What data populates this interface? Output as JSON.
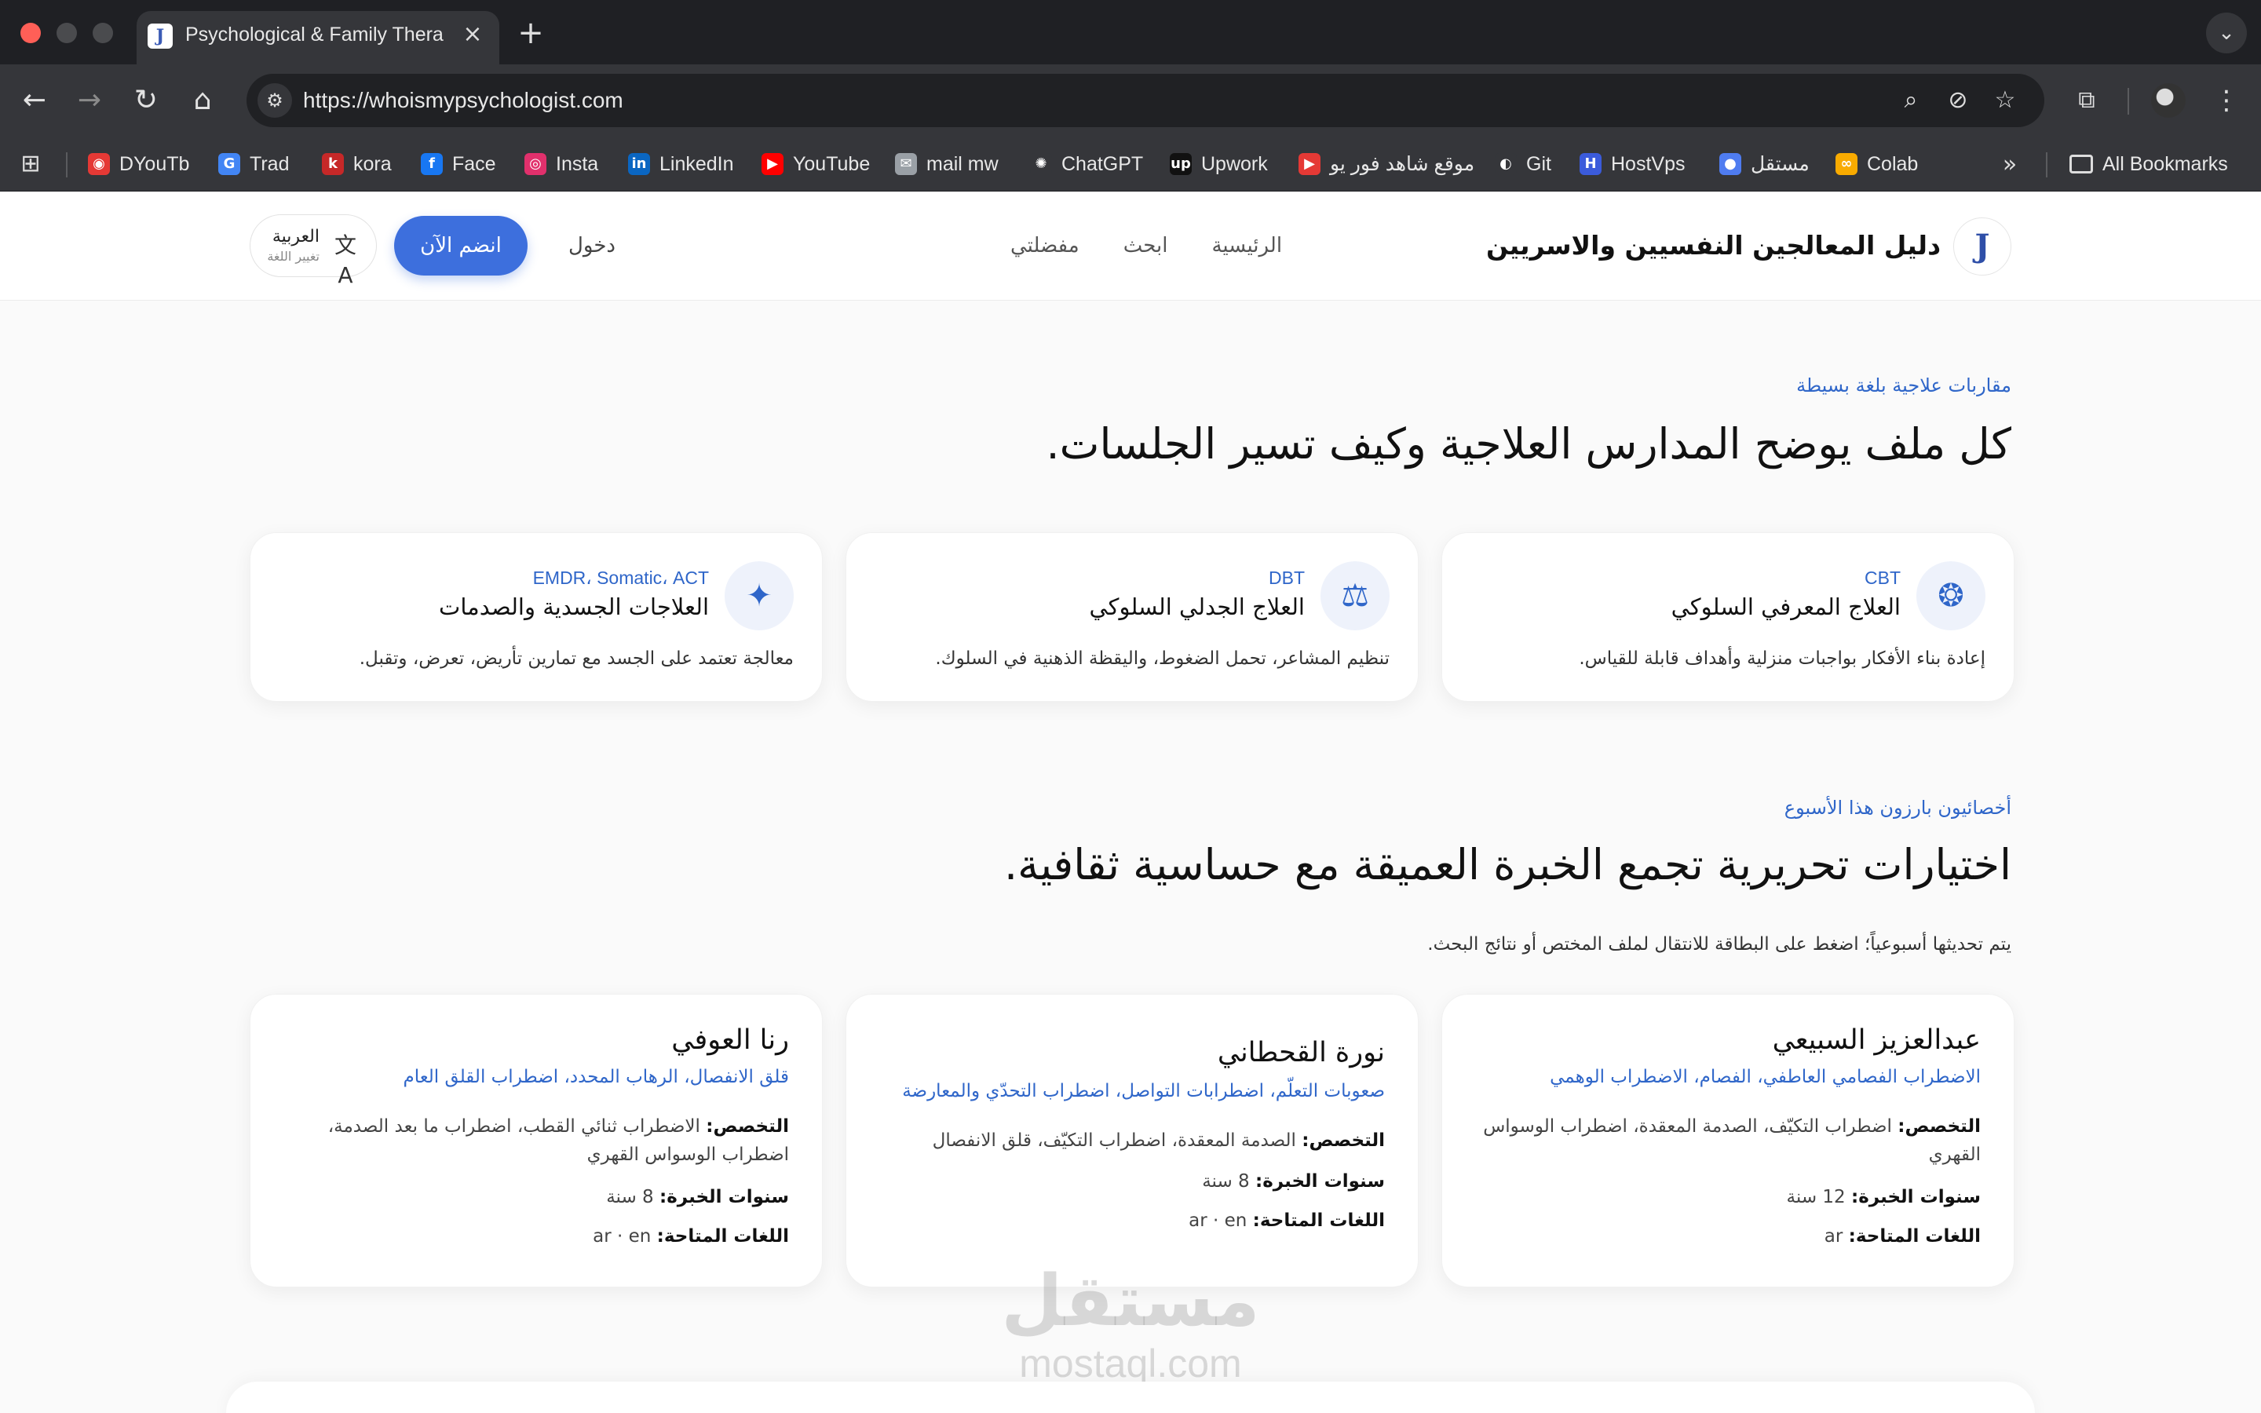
{
  "browser": {
    "tab_title": "Psychological & Family Thera",
    "url": "https://whoismypsychologist.com",
    "bookmarks": [
      {
        "label": "DYouTb",
        "color": "#e53935",
        "glyph": "◉"
      },
      {
        "label": "Trad",
        "color": "#4285f4",
        "glyph": "G"
      },
      {
        "label": "kora",
        "color": "#c62828",
        "glyph": "k"
      },
      {
        "label": "Face",
        "color": "#1877f2",
        "glyph": "f"
      },
      {
        "label": "Insta",
        "color": "#e1306c",
        "glyph": "◎"
      },
      {
        "label": "LinkedIn",
        "color": "#0a66c2",
        "glyph": "in"
      },
      {
        "label": "YouTube",
        "color": "#ff0000",
        "glyph": "▶"
      },
      {
        "label": "mail mw",
        "color": "#9aa0a6",
        "glyph": "✉"
      },
      {
        "label": "ChatGPT",
        "color": "#35363a",
        "glyph": "✺"
      },
      {
        "label": "Upwork",
        "color": "#111111",
        "glyph": "up"
      },
      {
        "label": "موقع شاهد فور يو",
        "color": "#e53935",
        "glyph": "▶"
      },
      {
        "label": "Git",
        "color": "#35363a",
        "glyph": "◐"
      },
      {
        "label": "HostVps",
        "color": "#3b5bdb",
        "glyph": "H"
      },
      {
        "label": "مستقل",
        "color": "#4f7cf0",
        "glyph": "●"
      },
      {
        "label": "Colab",
        "color": "#f9ab00",
        "glyph": "∞"
      }
    ],
    "all_bookmarks": "All Bookmarks"
  },
  "site": {
    "title": "دليل المعالجين النفسيين والاسريين",
    "logo_glyph": "J",
    "nav": [
      "الرئيسية",
      "ابحث",
      "مفضلتي"
    ],
    "login": "دخول",
    "join": "انضم الآن",
    "lang_name": "العربية",
    "lang_sub": "تغيير اللغة"
  },
  "approaches": {
    "eyebrow": "مقاربات علاجية بلغة بسيطة",
    "heading": "كل ملف يوضح المدارس العلاجية وكيف تسير الجلسات.",
    "items": [
      {
        "abbr": "CBT",
        "name": "العلاج المعرفي السلوكي",
        "desc": "إعادة بناء الأفكار بواجبات منزلية وأهداف قابلة للقياس.",
        "icon": "brain-icon",
        "glyph": "❂"
      },
      {
        "abbr": "DBT",
        "name": "العلاج الجدلي السلوكي",
        "desc": "تنظيم المشاعر، تحمل الضغوط، واليقظة الذهنية في السلوك.",
        "icon": "scale-icon",
        "glyph": "⚖"
      },
      {
        "abbr": "EMDR، Somatic، ACT",
        "name": "العلاجات الجسدية والصدمات",
        "desc": "معالجة تعتمد على الجسد مع تمارين تأريض، تعرض، وتقبل.",
        "icon": "sparkles-icon",
        "glyph": "✦"
      }
    ]
  },
  "featured": {
    "eyebrow": "أخصائيون بارزون هذا الأسبوع",
    "heading": "اختيارات تحريرية تجمع الخبرة العميقة مع حساسية ثقافية.",
    "lead": "يتم تحديثها أسبوعياً؛ اضغط على البطاقة للانتقال لملف المختص أو نتائج البحث.",
    "spec_label": "التخصص:",
    "years_label": "سنوات الخبرة:",
    "langs_label": "اللغات المتاحة:",
    "items": [
      {
        "name": "عبدالعزيز السبيعي",
        "tags": "الاضطراب الفصامي العاطفي، الفصام، الاضطراب الوهمي",
        "spec": "اضطراب التكيّف، الصدمة المعقدة، اضطراب الوسواس القهري",
        "years": "12 سنة",
        "langs": "ar"
      },
      {
        "name": "نورة القحطاني",
        "tags": "صعوبات التعلّم، اضطرابات التواصل، اضطراب التحدّي والمعارضة",
        "spec": "الصدمة المعقدة، اضطراب التكيّف، قلق الانفصال",
        "years": "8 سنة",
        "langs": "ar · en"
      },
      {
        "name": "رنا العوفي",
        "tags": "قلق الانفصال، الرهاب المحدد، اضطراب القلق العام",
        "spec": "الاضطراب ثنائي القطب، اضطراب ما بعد الصدمة، اضطراب الوسواس القهري",
        "years": "8 سنة",
        "langs": "ar · en"
      }
    ]
  },
  "watermark": {
    "ar": "مستقل",
    "en": "mostaql.com"
  }
}
